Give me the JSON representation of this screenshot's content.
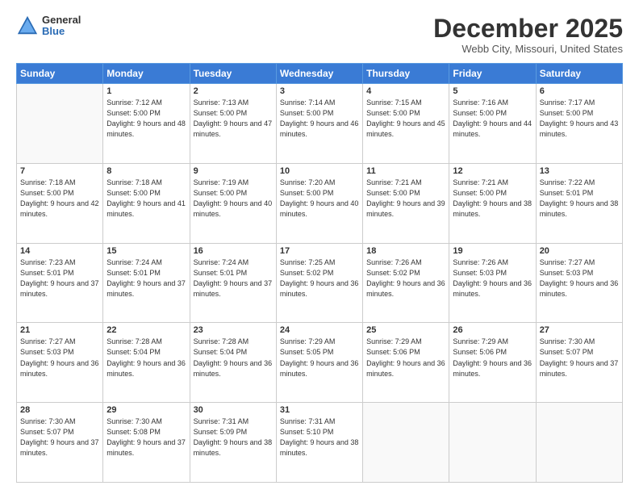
{
  "logo": {
    "general": "General",
    "blue": "Blue"
  },
  "header": {
    "month": "December 2025",
    "location": "Webb City, Missouri, United States"
  },
  "weekdays": [
    "Sunday",
    "Monday",
    "Tuesday",
    "Wednesday",
    "Thursday",
    "Friday",
    "Saturday"
  ],
  "weeks": [
    [
      {
        "day": "",
        "info": ""
      },
      {
        "day": "1",
        "info": "Sunrise: 7:12 AM\nSunset: 5:00 PM\nDaylight: 9 hours\nand 48 minutes."
      },
      {
        "day": "2",
        "info": "Sunrise: 7:13 AM\nSunset: 5:00 PM\nDaylight: 9 hours\nand 47 minutes."
      },
      {
        "day": "3",
        "info": "Sunrise: 7:14 AM\nSunset: 5:00 PM\nDaylight: 9 hours\nand 46 minutes."
      },
      {
        "day": "4",
        "info": "Sunrise: 7:15 AM\nSunset: 5:00 PM\nDaylight: 9 hours\nand 45 minutes."
      },
      {
        "day": "5",
        "info": "Sunrise: 7:16 AM\nSunset: 5:00 PM\nDaylight: 9 hours\nand 44 minutes."
      },
      {
        "day": "6",
        "info": "Sunrise: 7:17 AM\nSunset: 5:00 PM\nDaylight: 9 hours\nand 43 minutes."
      }
    ],
    [
      {
        "day": "7",
        "info": "Sunrise: 7:18 AM\nSunset: 5:00 PM\nDaylight: 9 hours\nand 42 minutes."
      },
      {
        "day": "8",
        "info": "Sunrise: 7:18 AM\nSunset: 5:00 PM\nDaylight: 9 hours\nand 41 minutes."
      },
      {
        "day": "9",
        "info": "Sunrise: 7:19 AM\nSunset: 5:00 PM\nDaylight: 9 hours\nand 40 minutes."
      },
      {
        "day": "10",
        "info": "Sunrise: 7:20 AM\nSunset: 5:00 PM\nDaylight: 9 hours\nand 40 minutes."
      },
      {
        "day": "11",
        "info": "Sunrise: 7:21 AM\nSunset: 5:00 PM\nDaylight: 9 hours\nand 39 minutes."
      },
      {
        "day": "12",
        "info": "Sunrise: 7:21 AM\nSunset: 5:00 PM\nDaylight: 9 hours\nand 38 minutes."
      },
      {
        "day": "13",
        "info": "Sunrise: 7:22 AM\nSunset: 5:01 PM\nDaylight: 9 hours\nand 38 minutes."
      }
    ],
    [
      {
        "day": "14",
        "info": "Sunrise: 7:23 AM\nSunset: 5:01 PM\nDaylight: 9 hours\nand 37 minutes."
      },
      {
        "day": "15",
        "info": "Sunrise: 7:24 AM\nSunset: 5:01 PM\nDaylight: 9 hours\nand 37 minutes."
      },
      {
        "day": "16",
        "info": "Sunrise: 7:24 AM\nSunset: 5:01 PM\nDaylight: 9 hours\nand 37 minutes."
      },
      {
        "day": "17",
        "info": "Sunrise: 7:25 AM\nSunset: 5:02 PM\nDaylight: 9 hours\nand 36 minutes."
      },
      {
        "day": "18",
        "info": "Sunrise: 7:26 AM\nSunset: 5:02 PM\nDaylight: 9 hours\nand 36 minutes."
      },
      {
        "day": "19",
        "info": "Sunrise: 7:26 AM\nSunset: 5:03 PM\nDaylight: 9 hours\nand 36 minutes."
      },
      {
        "day": "20",
        "info": "Sunrise: 7:27 AM\nSunset: 5:03 PM\nDaylight: 9 hours\nand 36 minutes."
      }
    ],
    [
      {
        "day": "21",
        "info": "Sunrise: 7:27 AM\nSunset: 5:03 PM\nDaylight: 9 hours\nand 36 minutes."
      },
      {
        "day": "22",
        "info": "Sunrise: 7:28 AM\nSunset: 5:04 PM\nDaylight: 9 hours\nand 36 minutes."
      },
      {
        "day": "23",
        "info": "Sunrise: 7:28 AM\nSunset: 5:04 PM\nDaylight: 9 hours\nand 36 minutes."
      },
      {
        "day": "24",
        "info": "Sunrise: 7:29 AM\nSunset: 5:05 PM\nDaylight: 9 hours\nand 36 minutes."
      },
      {
        "day": "25",
        "info": "Sunrise: 7:29 AM\nSunset: 5:06 PM\nDaylight: 9 hours\nand 36 minutes."
      },
      {
        "day": "26",
        "info": "Sunrise: 7:29 AM\nSunset: 5:06 PM\nDaylight: 9 hours\nand 36 minutes."
      },
      {
        "day": "27",
        "info": "Sunrise: 7:30 AM\nSunset: 5:07 PM\nDaylight: 9 hours\nand 37 minutes."
      }
    ],
    [
      {
        "day": "28",
        "info": "Sunrise: 7:30 AM\nSunset: 5:07 PM\nDaylight: 9 hours\nand 37 minutes."
      },
      {
        "day": "29",
        "info": "Sunrise: 7:30 AM\nSunset: 5:08 PM\nDaylight: 9 hours\nand 37 minutes."
      },
      {
        "day": "30",
        "info": "Sunrise: 7:31 AM\nSunset: 5:09 PM\nDaylight: 9 hours\nand 38 minutes."
      },
      {
        "day": "31",
        "info": "Sunrise: 7:31 AM\nSunset: 5:10 PM\nDaylight: 9 hours\nand 38 minutes."
      },
      {
        "day": "",
        "info": ""
      },
      {
        "day": "",
        "info": ""
      },
      {
        "day": "",
        "info": ""
      }
    ]
  ]
}
